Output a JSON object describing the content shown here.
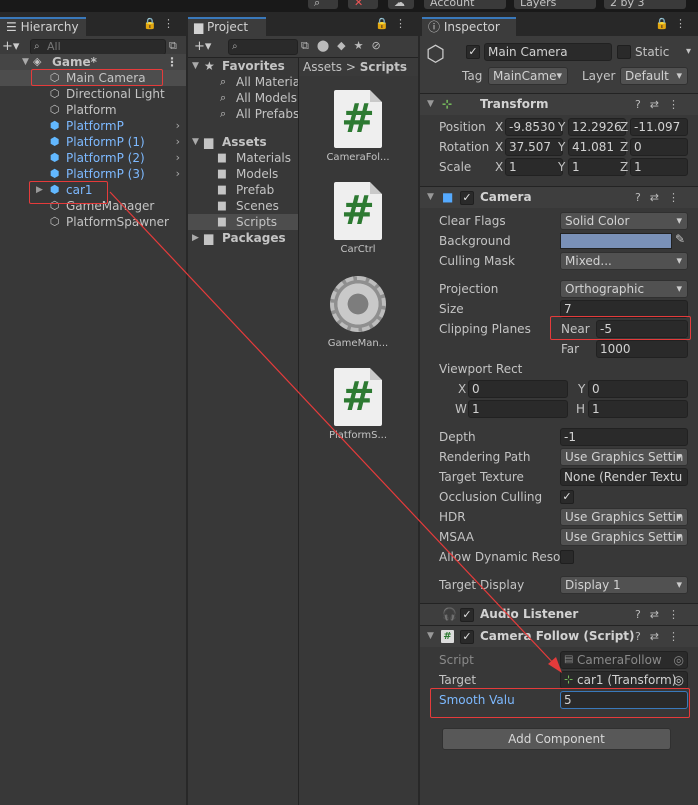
{
  "topbar": {
    "account": "Account",
    "layers": "Layers",
    "layout": "2 by 3"
  },
  "hierarchy": {
    "tab": "Hierarchy",
    "search_placeholder": "All",
    "scene": "Game*",
    "items": [
      {
        "label": "Main Camera",
        "prefab": false
      },
      {
        "label": "Directional Light",
        "prefab": false
      },
      {
        "label": "Platform",
        "prefab": false
      },
      {
        "label": "PlatformP",
        "prefab": true
      },
      {
        "label": "PlatformP (1)",
        "prefab": true
      },
      {
        "label": "PlatformP (2)",
        "prefab": true
      },
      {
        "label": "PlatformP (3)",
        "prefab": true
      },
      {
        "label": "car1",
        "prefab": true
      },
      {
        "label": "GameManager",
        "prefab": false
      },
      {
        "label": "PlatformSpawner",
        "prefab": false
      }
    ]
  },
  "project": {
    "tab": "Project",
    "breadcrumb": {
      "root": "Assets",
      "current": "Scripts"
    },
    "favorites": {
      "label": "Favorites",
      "items": [
        "All Materia",
        "All Models",
        "All Prefabs"
      ]
    },
    "assets": {
      "label": "Assets",
      "items": [
        "Materials",
        "Models",
        "Prefab",
        "Scenes",
        "Scripts"
      ]
    },
    "packages": "Packages",
    "files": [
      "CameraFol...",
      "CarCtrl",
      "GameMan...",
      "PlatformS..."
    ]
  },
  "inspector": {
    "tab": "Inspector",
    "object_name": "Main Camera",
    "static_label": "Static",
    "tag_label": "Tag",
    "tag_value": "MainCame",
    "layer_label": "Layer",
    "layer_value": "Default",
    "transform": {
      "title": "Transform",
      "position": {
        "label": "Position",
        "x": "-9.8530",
        "y": "12.2926",
        "z": "-11.097"
      },
      "rotation": {
        "label": "Rotation",
        "x": "37.507",
        "y": "41.081",
        "z": "0"
      },
      "scale": {
        "label": "Scale",
        "x": "1",
        "y": "1",
        "z": "1"
      }
    },
    "camera": {
      "title": "Camera",
      "clear_flags": {
        "label": "Clear Flags",
        "value": "Solid Color"
      },
      "background": {
        "label": "Background",
        "color": "#7a91b8"
      },
      "culling_mask": {
        "label": "Culling Mask",
        "value": "Mixed..."
      },
      "projection": {
        "label": "Projection",
        "value": "Orthographic"
      },
      "size": {
        "label": "Size",
        "value": "7"
      },
      "clipping": {
        "label": "Clipping Planes",
        "near_label": "Near",
        "near": "-5",
        "far_label": "Far",
        "far": "1000"
      },
      "viewport": {
        "label": "Viewport Rect",
        "x_label": "X",
        "x": "0",
        "y_label": "Y",
        "y": "0",
        "w_label": "W",
        "w": "1",
        "h_label": "H",
        "h": "1"
      },
      "depth": {
        "label": "Depth",
        "value": "-1"
      },
      "rendering_path": {
        "label": "Rendering Path",
        "value": "Use Graphics Settin"
      },
      "target_texture": {
        "label": "Target Texture",
        "value": "None (Render Textu"
      },
      "occlusion": {
        "label": "Occlusion Culling"
      },
      "hdr": {
        "label": "HDR",
        "value": "Use Graphics Settin"
      },
      "msaa": {
        "label": "MSAA",
        "value": "Use Graphics Settin"
      },
      "dynamic_res": {
        "label": "Allow Dynamic Resol"
      },
      "target_display": {
        "label": "Target Display",
        "value": "Display 1"
      }
    },
    "audio_listener": {
      "title": "Audio Listener"
    },
    "camera_follow": {
      "title": "Camera Follow (Script)",
      "script": {
        "label": "Script",
        "value": "CameraFollow"
      },
      "target": {
        "label": "Target",
        "value": "car1 (Transform)"
      },
      "smooth": {
        "label": "Smooth Valu",
        "value": "5"
      }
    },
    "add_component": "Add Component"
  },
  "colors": {
    "accent": "#3a79bb",
    "highlight": "#e53b3b",
    "prefab": "#7db9ff"
  }
}
